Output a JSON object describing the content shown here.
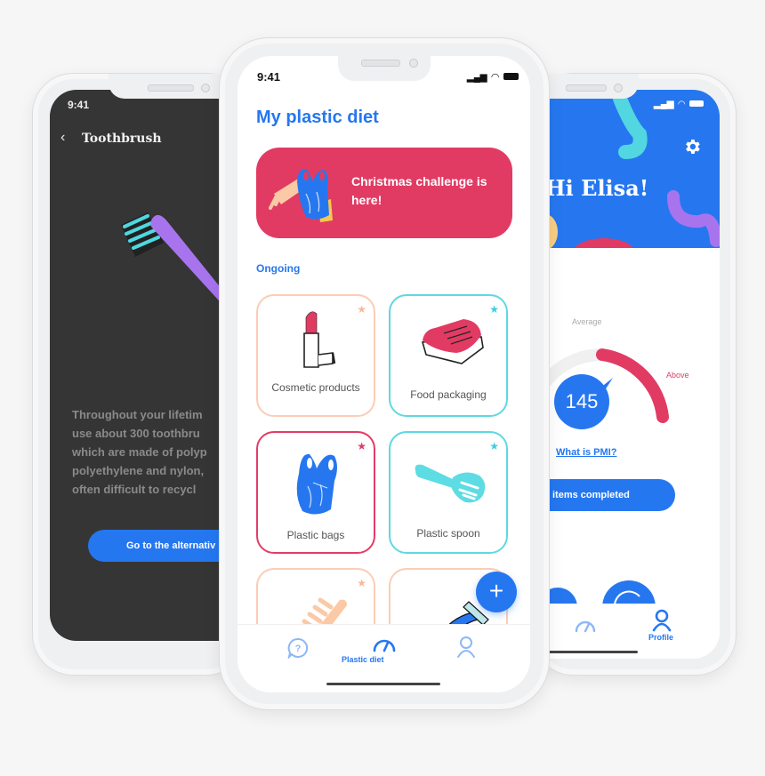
{
  "left_phone": {
    "status_time": "9:41",
    "back_icon": "chevron-left-icon",
    "title": "Toothbrush",
    "illustration": "toothbrush-illustration",
    "body_lines": [
      "Throughout your lifetim",
      "use about 300 toothbru",
      "which are made of polyp",
      "polyethylene and nylon,",
      "often difficult to recycl"
    ],
    "button_label": "Go to the alternativ"
  },
  "center_phone": {
    "status_time": "9:41",
    "status_icons": [
      "signal-icon",
      "wifi-icon",
      "battery-icon"
    ],
    "title": "My plastic diet",
    "banner": {
      "text": "Christmas challenge is here!",
      "color": "#e13b63",
      "illustration": "comb-and-bag-illustration"
    },
    "section_label": "Ongoing",
    "cards": [
      {
        "label": "Cosmetic products",
        "icon": "lipstick-icon",
        "border": "#fbcdb6",
        "star": "#f9b89b"
      },
      {
        "label": "Food packaging",
        "icon": "food-tray-icon",
        "border": "#5fd8e0",
        "star": "#3fcfdc"
      },
      {
        "label": "Plastic bags",
        "icon": "plastic-bag-icon",
        "border": "#e23d66",
        "star": "#e23d66"
      },
      {
        "label": "Plastic spoon",
        "icon": "spatula-icon",
        "border": "#5fd8e0",
        "star": "#3fcfdc"
      },
      {
        "label": "",
        "icon": "comb-icon",
        "border": "#fbcdb6",
        "star": "#f9b89b"
      },
      {
        "label": "",
        "icon": "razor-icon",
        "border": "#fbcdb6",
        "star": ""
      }
    ],
    "fab_label": "+",
    "nav": [
      {
        "label": "",
        "icon": "help-bubble-icon",
        "active": false
      },
      {
        "label": "Plastic diet",
        "icon": "gauge-icon",
        "active": true
      },
      {
        "label": "",
        "icon": "profile-icon",
        "active": false
      }
    ]
  },
  "right_phone": {
    "status_icons": [
      "signal-icon",
      "wifi-icon",
      "battery-icon"
    ],
    "greeting": "Hi Elisa!",
    "settings_icon": "gear-icon",
    "gauge": {
      "label_average": "Average",
      "label_above": "Above",
      "value": "145",
      "level": "above"
    },
    "pmi_link": "What is PMI?",
    "button_label": "items completed",
    "nav": [
      {
        "label": "",
        "icon": "gauge-icon",
        "active": false
      },
      {
        "label": "Profile",
        "icon": "profile-icon",
        "active": true
      }
    ]
  },
  "colors": {
    "brand_blue": "#2577f0",
    "accent_pink": "#e13b63",
    "teal": "#5fd8e0",
    "peach": "#fbcdb6",
    "purple": "#a774ee",
    "dark_bg": "#353535"
  }
}
